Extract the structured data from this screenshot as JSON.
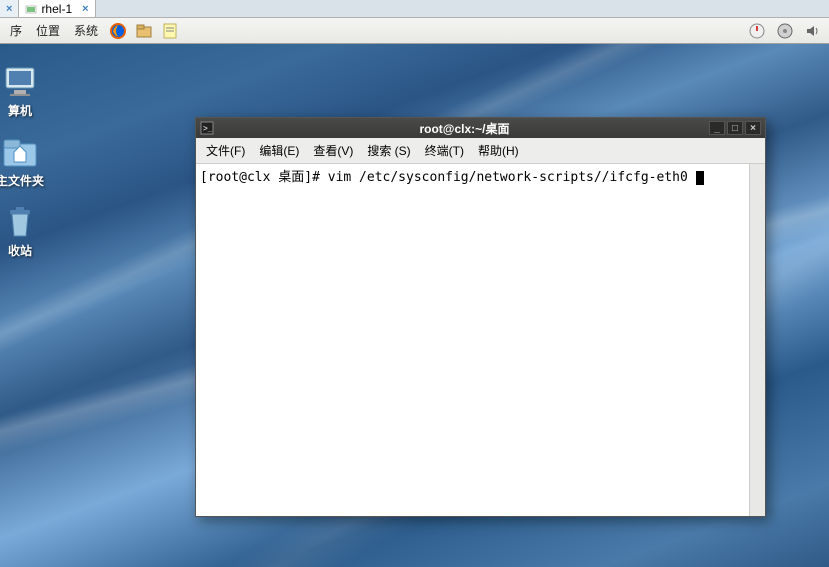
{
  "vm_tabs": [
    {
      "label": "",
      "active": false
    },
    {
      "label": "rhel-1",
      "active": true
    }
  ],
  "panel": {
    "menus": [
      "序",
      "位置",
      "系统"
    ]
  },
  "desktop_icons": [
    {
      "label": "算机"
    },
    {
      "label": "主文件夹"
    },
    {
      "label": "收站"
    }
  ],
  "terminal": {
    "title": "root@clx:~/桌面",
    "menus": [
      "文件(F)",
      "编辑(E)",
      "查看(V)",
      "搜索 (S)",
      "终端(T)",
      "帮助(H)"
    ],
    "prompt": "[root@clx 桌面]# vim /etc/sysconfig/network-scripts//ifcfg-eth0 "
  }
}
